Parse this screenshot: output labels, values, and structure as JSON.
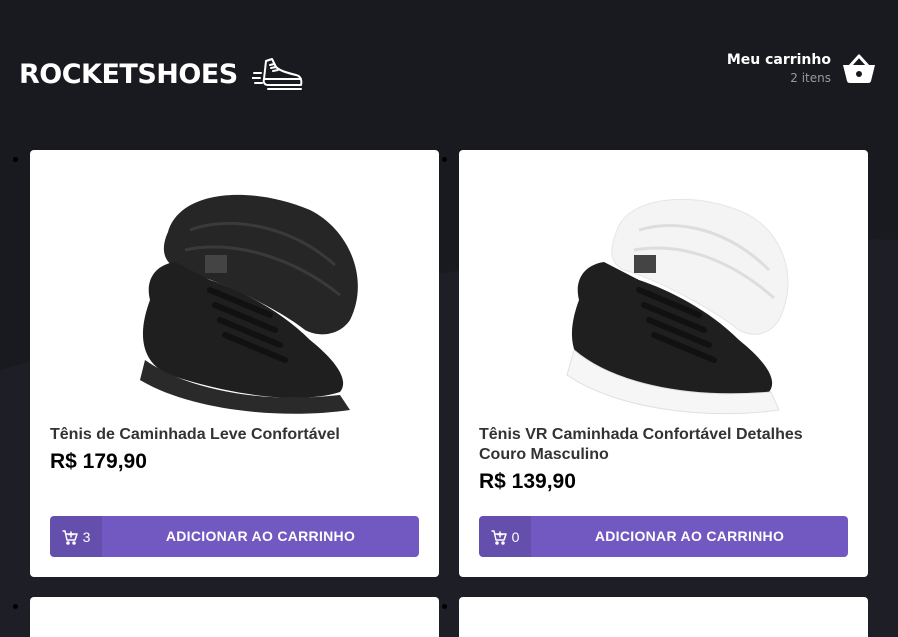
{
  "header": {
    "logo_text": "ROCKETSHOES",
    "logo_icon": "running-shoe-icon",
    "cart_title": "Meu carrinho",
    "cart_count": "2 itens",
    "cart_icon": "basket-icon"
  },
  "products": [
    {
      "title": "Tênis de Caminhada Leve Confortável",
      "price": "R$ 179,90",
      "amount": "3",
      "button_label": "ADICIONAR AO CARRINHO",
      "shoe_colors": {
        "upper": "#1f1f1f",
        "sole": "#2a2a2a"
      }
    },
    {
      "title": "Tênis VR Caminhada Confortável Detalhes Couro Masculino",
      "price": "R$ 139,90",
      "amount": "0",
      "button_label": "ADICIONAR AO CARRINHO",
      "shoe_colors": {
        "upper": "#1f1f1f",
        "sole": "#f4f4f4"
      }
    }
  ],
  "colors": {
    "background": "#191920",
    "accent": "#7159c1"
  }
}
